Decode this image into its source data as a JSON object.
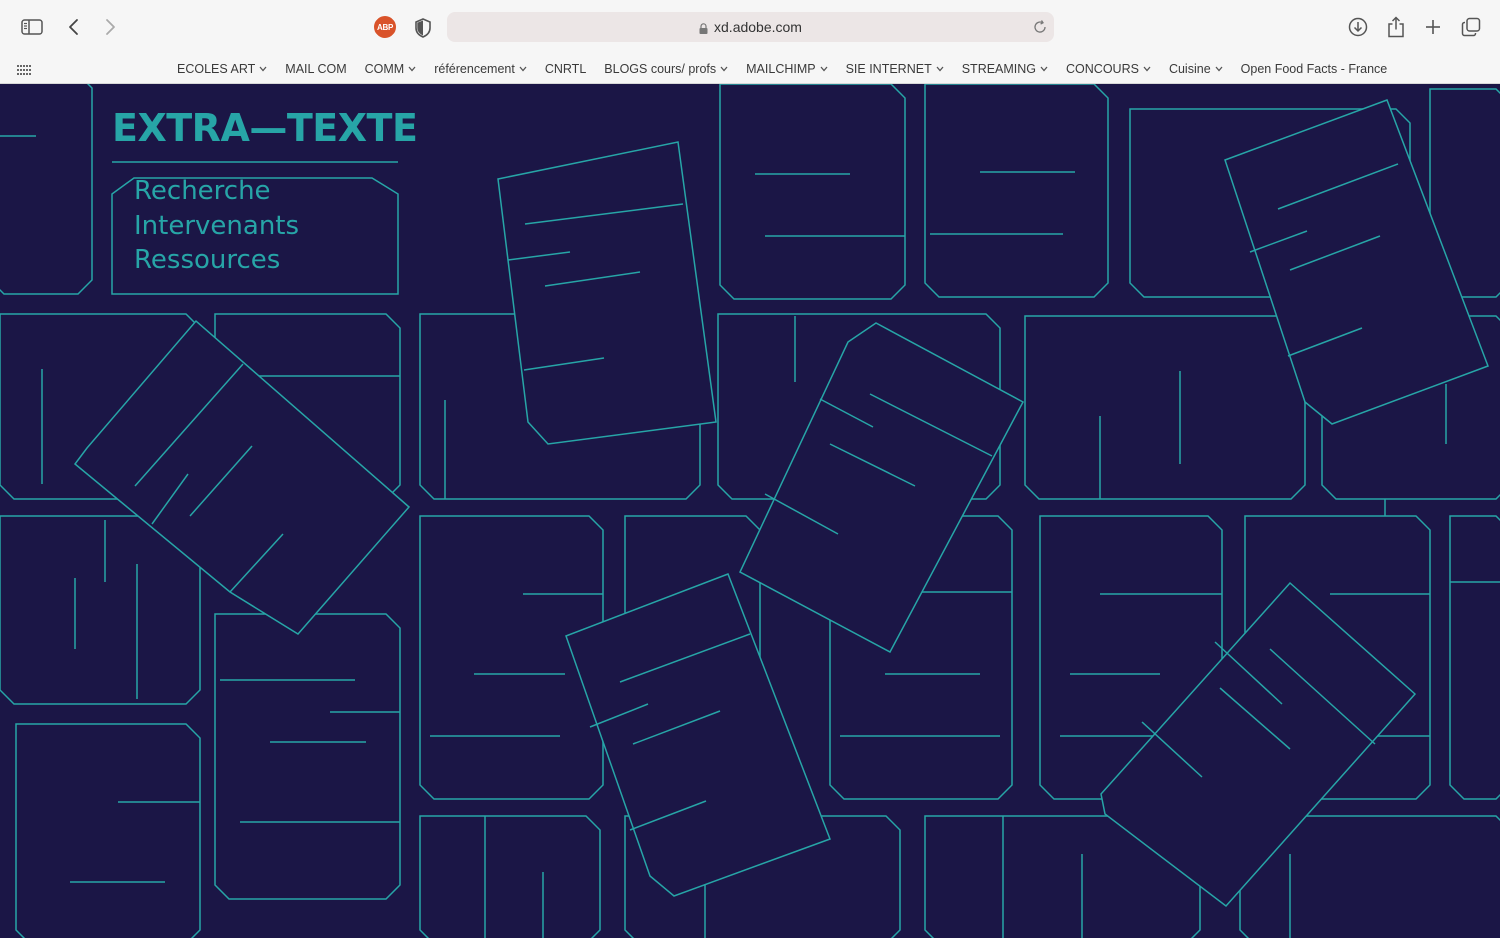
{
  "browser": {
    "url": "xd.adobe.com",
    "extension_badge": "ABP",
    "icons": {
      "sidebar": "sidebar-icon",
      "back": "back-chevron-icon",
      "forward": "forward-chevron-icon",
      "privacy": "shield-icon",
      "lock": "lock-icon",
      "reload": "reload-icon",
      "downloads": "download-icon",
      "share": "share-icon",
      "new_tab": "plus-icon",
      "tabs": "tab-overview-icon"
    }
  },
  "bookmarks": [
    {
      "label": "ECOLES ART",
      "folder": true
    },
    {
      "label": "MAIL COM",
      "folder": false
    },
    {
      "label": "COMM",
      "folder": true
    },
    {
      "label": "référencement",
      "folder": true
    },
    {
      "label": "CNRTL",
      "folder": false
    },
    {
      "label": "BLOGS cours/ profs",
      "folder": true
    },
    {
      "label": "MAILCHIMP",
      "folder": true
    },
    {
      "label": "SIE INTERNET",
      "folder": true
    },
    {
      "label": "STREAMING",
      "folder": true
    },
    {
      "label": "CONCOURS",
      "folder": true
    },
    {
      "label": "Cuisine",
      "folder": true
    },
    {
      "label": "Open Food Facts - France",
      "folder": false
    }
  ],
  "site": {
    "logo": "EXTRA—TEXTE",
    "nav": [
      "Recherche",
      "Intervenants",
      "Ressources"
    ]
  },
  "colors": {
    "page_bg": "#1b1646",
    "accent": "#27a5a7",
    "toolbar_bg": "#f6f6f6",
    "address_bg": "#ece6e6"
  }
}
